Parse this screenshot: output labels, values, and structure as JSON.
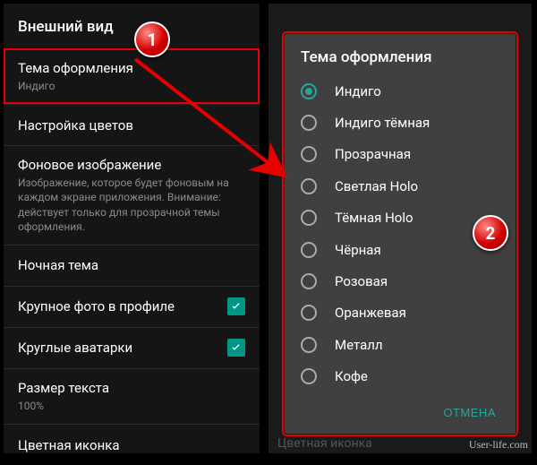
{
  "left": {
    "header": "Внешний вид",
    "themeSetting": {
      "title": "Тема оформления",
      "value": "Индиго"
    },
    "colors": {
      "title": "Настройка цветов"
    },
    "background": {
      "title": "Фоновое изображение",
      "desc": "Изображение, которое будет фоновым на каждом экране приложения. Внимание: действует только для прозрачной темы оформления."
    },
    "nightTheme": {
      "title": "Ночная тема"
    },
    "bigPhoto": {
      "title": "Крупное фото в профиле"
    },
    "roundAvatars": {
      "title": "Круглые аватарки"
    },
    "textSize": {
      "title": "Размер текста",
      "value": "100%"
    },
    "colorIcon": {
      "title": "Цветная иконка"
    }
  },
  "dialog": {
    "title": "Тема оформления",
    "options": [
      {
        "label": "Индиго",
        "selected": true
      },
      {
        "label": "Индиго тёмная",
        "selected": false
      },
      {
        "label": "Прозрачная",
        "selected": false
      },
      {
        "label": "Светлая Holo",
        "selected": false
      },
      {
        "label": "Тёмная Holo",
        "selected": false
      },
      {
        "label": "Чёрная",
        "selected": false
      },
      {
        "label": "Розовая",
        "selected": false
      },
      {
        "label": "Оранжевая",
        "selected": false
      },
      {
        "label": "Металл",
        "selected": false
      },
      {
        "label": "Кофе",
        "selected": false
      }
    ],
    "cancel": "ОТМЕНА"
  },
  "rightFaded": {
    "colorIcon": "Цветная иконка"
  },
  "badges": {
    "one": "1",
    "two": "2"
  },
  "watermark": "User-life.com"
}
